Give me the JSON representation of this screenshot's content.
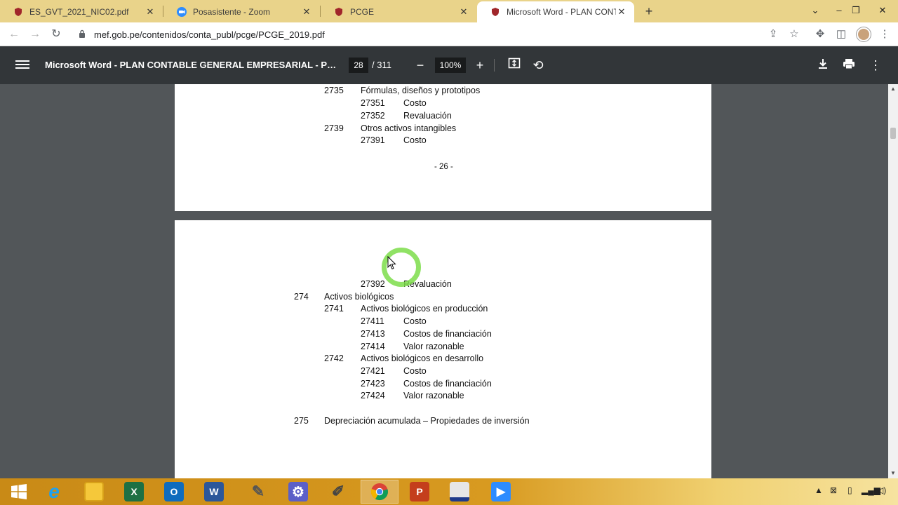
{
  "browser": {
    "tabs": [
      {
        "title": "ES_GVT_2021_NIC02.pdf",
        "icon": "mef-shield-icon"
      },
      {
        "title": "Posasistente - Zoom",
        "icon": "zoom-icon"
      },
      {
        "title": "PCGE",
        "icon": "mef-shield-icon"
      },
      {
        "title": "Microsoft Word - PLAN CONTABLE",
        "icon": "mef-shield-icon",
        "active": true
      }
    ],
    "new_tab": "+",
    "url": "mef.gob.pe/contenidos/conta_publ/pcge/PCGE_2019.pdf"
  },
  "pdf_viewer": {
    "title": "Microsoft Word - PLAN CONTABLE GENERAL EMPRESARIAL - PCGE...",
    "page_current": "28",
    "page_total": "/ 311",
    "zoom": "100%"
  },
  "document": {
    "page1": {
      "lines": [
        {
          "code": "2735",
          "text": "Fórmulas, diseños y prototipos",
          "level": 2
        },
        {
          "code": "27351",
          "text": "Costo",
          "level": 3
        },
        {
          "code": "27352",
          "text": "Revaluación",
          "level": 3
        },
        {
          "code": "2739",
          "text": "Otros activos intangibles",
          "level": 2
        },
        {
          "code": "27391",
          "text": "Costo",
          "level": 3
        }
      ],
      "page_number": "- 26 -"
    },
    "page2": {
      "lines": [
        {
          "code": "27392",
          "text": "Revaluación",
          "level": 3
        },
        {
          "code": "274",
          "text": "Activos biológicos",
          "level": 1
        },
        {
          "code": "2741",
          "text": "Activos biológicos en producción",
          "level": 2
        },
        {
          "code": "27411",
          "text": "Costo",
          "level": 3
        },
        {
          "code": "27413",
          "text": "Costos de financiación",
          "level": 3
        },
        {
          "code": "27414",
          "text": "Valor razonable",
          "level": 3
        },
        {
          "code": "2742",
          "text": "Activos biológicos en desarrollo",
          "level": 2
        },
        {
          "code": "27421",
          "text": "Costo",
          "level": 3
        },
        {
          "code": "27423",
          "text": "Costos de financiación",
          "level": 3
        },
        {
          "code": "27424",
          "text": "Valor razonable",
          "level": 3
        },
        {
          "code": "275",
          "text": "Depreciación acumulada – Propiedades de inversión",
          "level": 1
        }
      ]
    }
  },
  "taskbar": {
    "apps": [
      "start-icon",
      "internet-explorer-icon",
      "file-explorer-icon",
      "excel-icon",
      "outlook-icon",
      "word-icon",
      "paint-icon",
      "settings-icon",
      "tool-icon",
      "chrome-icon",
      "powerpoint-icon",
      "app-icon",
      "zoom-icon"
    ]
  },
  "colors": {
    "tabstrip": "#e9d38a",
    "pdf_toolbar": "#323639",
    "viewer_bg": "#525659",
    "cursor_highlight": "#7ddd4a"
  }
}
